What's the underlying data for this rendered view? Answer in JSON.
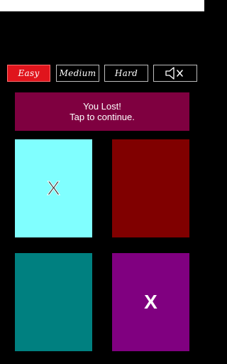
{
  "difficulty": {
    "easy_label": "Easy",
    "medium_label": "Medium",
    "hard_label": "Hard",
    "selected": "Easy"
  },
  "sound_icon": "speaker-muted-icon",
  "message": {
    "line1": "You Lost!",
    "line2": "Tap to continue."
  },
  "tiles": [
    {
      "color": "#80ffff",
      "mark": "X"
    },
    {
      "color": "#800000",
      "mark": ""
    },
    {
      "color": "#008080",
      "mark": ""
    },
    {
      "color": "#800080",
      "mark": "X"
    }
  ],
  "colors": {
    "background": "#000000",
    "selected_button": "#e0141c",
    "message_bg": "#7f0040"
  }
}
